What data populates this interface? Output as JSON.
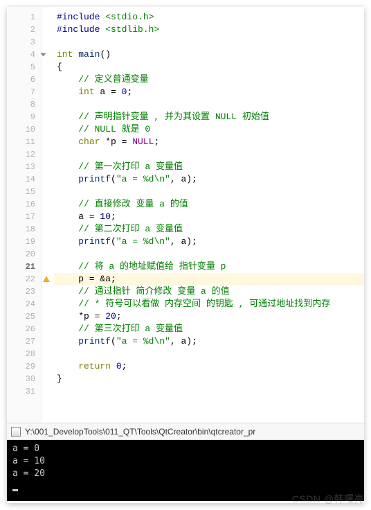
{
  "code_lines": [
    {
      "n": 1,
      "html": "<span class='pp'>#include</span> <span class='str'>&lt;stdio.h&gt;</span>"
    },
    {
      "n": 2,
      "html": "<span class='pp'>#include</span> <span class='str'>&lt;stdlib.h&gt;</span>"
    },
    {
      "n": 3,
      "html": ""
    },
    {
      "n": 4,
      "fold": true,
      "html": "<span class='kw'>int</span> <span class='id'>main</span>()"
    },
    {
      "n": 5,
      "html": "{"
    },
    {
      "n": 6,
      "html": "    <span class='cmt'>// 定义普通变量</span>"
    },
    {
      "n": 7,
      "html": "    <span class='kw'>int</span> a = <span class='num'>0</span>;"
    },
    {
      "n": 8,
      "html": ""
    },
    {
      "n": 9,
      "html": "    <span class='cmt'>// 声明指针变量 , 并为其设置 NULL 初始值</span>"
    },
    {
      "n": 10,
      "html": "    <span class='cmt'>// NULL 就是 0</span>"
    },
    {
      "n": 11,
      "html": "    <span class='kw'>char</span> *p = <span class='ty'>NULL</span>;"
    },
    {
      "n": 12,
      "html": ""
    },
    {
      "n": 13,
      "html": "    <span class='cmt'>// 第一次打印 a 变量值</span>"
    },
    {
      "n": 14,
      "html": "    <span class='id'>printf</span>(<span class='str'>\"a = %d\\n\"</span>, a);"
    },
    {
      "n": 15,
      "html": ""
    },
    {
      "n": 16,
      "html": "    <span class='cmt'>// 直接修改 变量 a 的值</span>"
    },
    {
      "n": 17,
      "html": "    a = <span class='num'>10</span>;"
    },
    {
      "n": 18,
      "html": "    <span class='cmt'>// 第二次打印 a 变量值</span>"
    },
    {
      "n": 19,
      "html": "    <span class='id'>printf</span>(<span class='str'>\"a = %d\\n\"</span>, a);"
    },
    {
      "n": 20,
      "html": ""
    },
    {
      "n": 21,
      "current": true,
      "html": "    <span class='cmt'>// 将 a 的地址赋值给 指针变量 p</span>"
    },
    {
      "n": 22,
      "warn": true,
      "hl": true,
      "html": "    p = &amp;a;"
    },
    {
      "n": 23,
      "html": "    <span class='cmt'>// 通过指针 简介修改 变量 a 的值</span>"
    },
    {
      "n": 24,
      "html": "    <span class='cmt'>// * 符号可以看做 内存空间 的钥匙 , 可通过地址找到内存</span>"
    },
    {
      "n": 25,
      "html": "    *p = <span class='num'>20</span>;"
    },
    {
      "n": 26,
      "html": "    <span class='cmt'>// 第三次打印 a 变量值</span>"
    },
    {
      "n": 27,
      "html": "    <span class='id'>printf</span>(<span class='str'>\"a = %d\\n\"</span>, a);"
    },
    {
      "n": 28,
      "html": ""
    },
    {
      "n": 29,
      "html": "    <span class='kw'>return</span> <span class='num'>0</span>;"
    },
    {
      "n": 30,
      "html": "}"
    },
    {
      "n": 31,
      "html": ""
    }
  ],
  "console": {
    "title": "Y:\\001_DevelopTools\\011_QT\\Tools\\QtCreator\\bin\\qtcreator_pr",
    "output": [
      "a = 0",
      "a = 10",
      "a = 20"
    ]
  },
  "watermark": "CSDN @韩曙亮"
}
